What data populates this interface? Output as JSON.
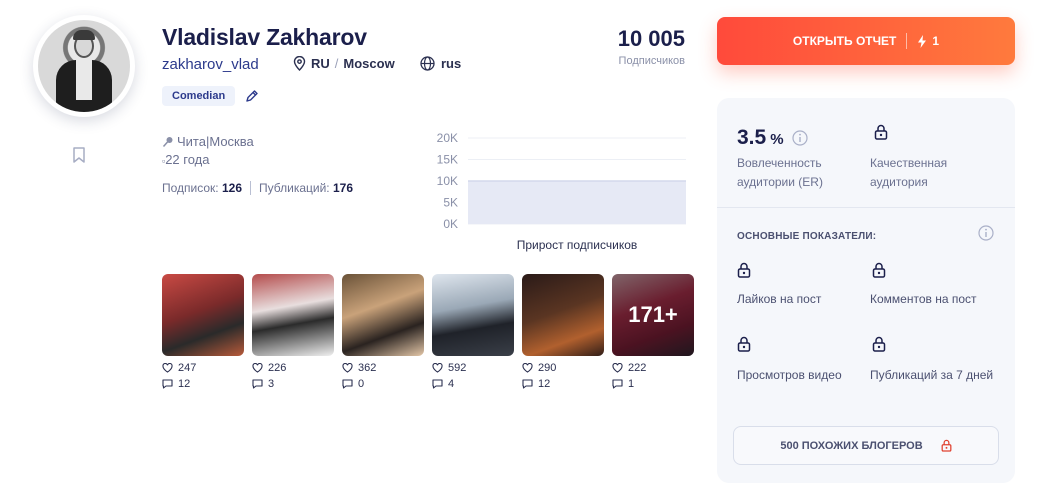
{
  "profile": {
    "name": "Vladislav Zakharov",
    "username": "zakharov_vlad",
    "country": "RU",
    "city_geo": "Moscow",
    "language": "rus",
    "category": "Comedian",
    "followers_value": "10 005",
    "followers_label": "Подписчиков",
    "city_bio": "Чита|Москва",
    "age": "22 года",
    "following_label": "Подписок:",
    "following_value": "126",
    "posts_label": "Публикаций:",
    "posts_value": "176"
  },
  "chart_data": {
    "type": "area",
    "title": "",
    "xlabel": "Прирост подписчиков",
    "ylabel": "",
    "yticks": [
      "0K",
      "5K",
      "10K",
      "15K",
      "20K"
    ],
    "ylim": [
      0,
      20000
    ],
    "values": [
      10005,
      10005
    ],
    "color": "#e6e9f5"
  },
  "posts": [
    {
      "likes": "247",
      "comments": "12"
    },
    {
      "likes": "226",
      "comments": "3"
    },
    {
      "likes": "362",
      "comments": "0"
    },
    {
      "likes": "592",
      "comments": "4"
    },
    {
      "likes": "290",
      "comments": "12"
    },
    {
      "likes": "222",
      "comments": "1",
      "more": "171+"
    }
  ],
  "report_button": {
    "label": "ОТКРЫТЬ ОТЧЕТ",
    "credits": "1"
  },
  "panel": {
    "er_value": "3.5",
    "er_unit": "%",
    "er_label": "Вовлеченность аудитории (ER)",
    "quality_label": "Качественная аудитория",
    "main_title": "ОСНОВНЫЕ ПОКАЗАТЕЛИ:",
    "metrics": [
      "Лайков на пост",
      "Комментов на пост",
      "Просмотров видео",
      "Публикаций за 7 дней"
    ],
    "similar_label": "500 ПОХОЖИХ БЛОГЕРОВ"
  },
  "colors": {
    "accent": "#ff5a3c",
    "text_dark": "#1b1f4b",
    "link": "#2c3a8c",
    "muted": "#6b7190"
  }
}
